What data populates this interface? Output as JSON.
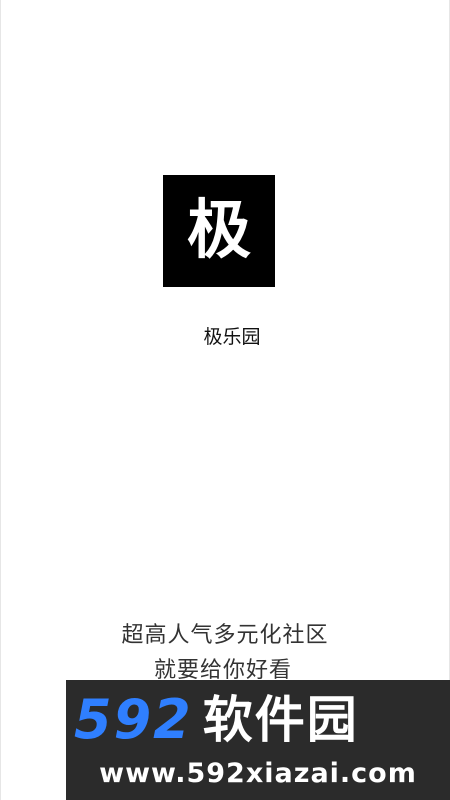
{
  "app": {
    "logo_char": "极",
    "name": "极乐园"
  },
  "slogan": {
    "line1": "超高人气多元化社区",
    "line2": "就要给你好看"
  },
  "watermark": {
    "brand_number": "592",
    "brand_name": "软件园",
    "url": "www.592xiazai.com"
  },
  "colors": {
    "background": "#ffffff",
    "logo_bg": "#000000",
    "watermark_bg": "#2b2b2b",
    "watermark_accent": "#2f7fff"
  }
}
